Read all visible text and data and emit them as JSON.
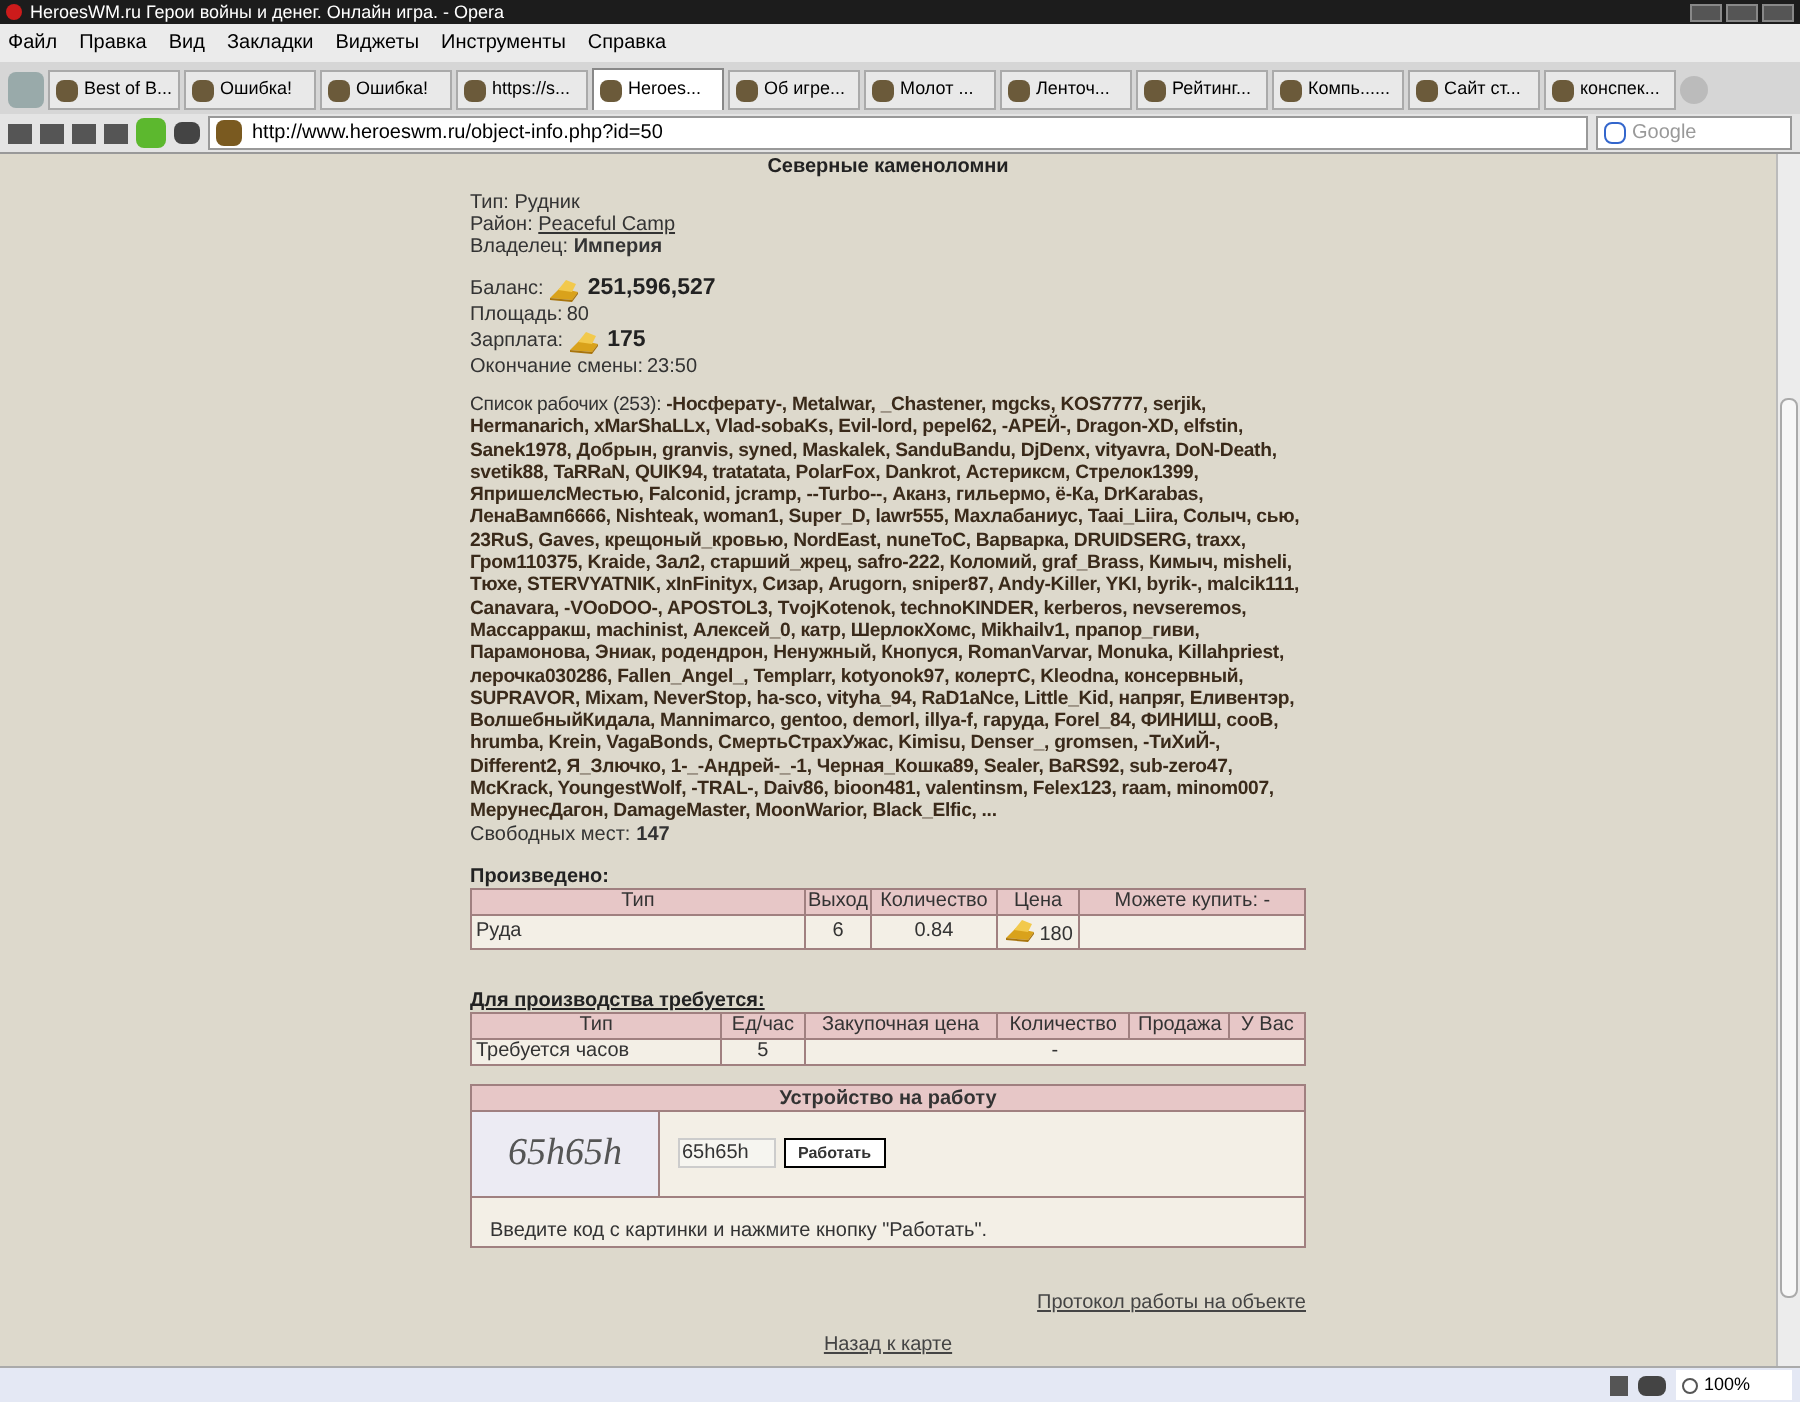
{
  "window": {
    "title": "HeroesWM.ru Герои войны и денег. Онлайн игра. - Opera"
  },
  "menu": [
    "Файл",
    "Правка",
    "Вид",
    "Закладки",
    "Виджеты",
    "Инструменты",
    "Справка"
  ],
  "tabs": [
    {
      "label": "Best of B...",
      "selected": false
    },
    {
      "label": "Ошибка!",
      "selected": false
    },
    {
      "label": "Ошибка!",
      "selected": false
    },
    {
      "label": "https://s...",
      "selected": false
    },
    {
      "label": "Heroes...",
      "selected": true
    },
    {
      "label": "Об игре...",
      "selected": false
    },
    {
      "label": "Молот ...",
      "selected": false
    },
    {
      "label": "Ленточ...",
      "selected": false
    },
    {
      "label": "Рейтинг...",
      "selected": false
    },
    {
      "label": "Компь......",
      "selected": false
    },
    {
      "label": "Сайт ст...",
      "selected": false
    },
    {
      "label": "конспек...",
      "selected": false
    }
  ],
  "address_bar": {
    "url": "http://www.heroeswm.ru/object-info.php?id=50",
    "search_placeholder": "Google"
  },
  "page": {
    "title": "Северные каменоломни",
    "info": [
      {
        "label": "Тип:",
        "value": "Рудник",
        "kind": "plain"
      },
      {
        "label": "Район:",
        "value": "Peaceful Camp",
        "kind": "link"
      },
      {
        "label": "Владелец:",
        "value": "Империя",
        "kind": "bold"
      }
    ],
    "stats": [
      {
        "label": "Баланс:",
        "value": "251,596,527",
        "kind": "gold"
      },
      {
        "label": "Площадь:",
        "value": "80",
        "kind": "plain"
      },
      {
        "label": "Зарплата:",
        "value": "175",
        "kind": "gold"
      },
      {
        "label": "Окончание смены:",
        "value": "23:50",
        "kind": "plain"
      }
    ],
    "workers": {
      "label": "Список рабочих (253):",
      "names": "-Носферату-, Metalwar, _Chastener, mgcks, KOS7777, serjik, Hermanarich, xMarShaLLx, Vlad-sobaKs, Evil-lord, pepel62, -АРЕЙ-, Dragon-XD, elfstin, Sanek1978, Добрын, granvis, syned, Maskalek, SanduBandu, DjDenx, vityavra, DoN-Death, svetik88, TaRRaN, QUIK94, tratatata, PolarFox, Dankrot, Астериксм, Стрелок1399, ЯпришелсМестью, Falconid, jcramp, --Turbo--, Аканз, гильермо, ё-Ка, DrKarabas, ЛенаВамп6666, Nishteak, woman1, Super_D, lawr555, Махлабаниус, Taai_Liira, Солыч, сью, 23RuS, Gaves, крещоный_кровью, NordEast, nuneToC, Варварка, DRUIDSERG, traxx, Гром110375, Kraide, Зал2, старший_жрец, safro-222, Коломий, graf_Brass, Кимыч, misheli, Тюхе, STERVYATNIK, xInFinityx, Сизар, Arugorn, sniper87, Andy-Killer, YKI, byrik-, malcik111, Canavara, -VOoDOO-, APOSTOL3, TvojKotenok, technoKINDER, kerberos, nevseremos, Массарракш, machinist, Алексей_0, катр, ШерлокХомс, Mikhailv1, прапор_гиви, Парамонова, Эниак, родендрон, Ненужный, Кнопуся, RomanVarvar, Monuka, Killahpriest, лерочка030286, Fallen_Angel_, Templarr, kotyonok97, колертС, Kleodna, консервный, SUPRAVOR, Mixam, NeverStop, ha-sco, vityha_94, RaD1aNce, Little_Kid, напряг, Еливентэр, ВолшебныйКидала, Mannimarco, gentoo, demorl, illya-f, гаруда, Forel_84, ФИНИШ, cooB, hrumba, Krein, VagaBonds, СмертьСтрахУжас, Kimisu, Denser_, gromsen, -ТиХиЙ-, Different2, Я_Злючко, 1-_-Андрей-_-1, Черная_Кошка89, Sealer, BaRS92, sub-zero47, McKrack, YoungestWolf, -TRAL-, Daiv86, bioon481, valentinsm, Felex123, raam, minom007, МерунесДагон, DamageMaster, MoonWarior, Black_Elfic, ..."
    },
    "free_slots": {
      "label": "Свободных мест:",
      "value": "147"
    },
    "produced": {
      "heading": "Произведено:",
      "columns": [
        "Тип",
        "Выход",
        "Количество",
        "Цена",
        "Можете купить: -"
      ],
      "rows": [
        [
          "Руда",
          "6",
          "0.84",
          "180",
          ""
        ]
      ]
    },
    "required": {
      "heading": "Для производства требуется:",
      "columns": [
        "Тип",
        "Ед/час",
        "Закупочная цена",
        "Количество",
        "Продажа",
        "У Вас"
      ],
      "rows": [
        [
          "Требуется часов",
          "5",
          {
            "text": "-",
            "colspan": 4
          }
        ]
      ]
    },
    "employment": {
      "heading": "Устройство на работу",
      "captcha_text": "65h65h",
      "code_value": "65h65h",
      "button": "Работать",
      "hint": "Введите код с картинки и нажмите кнопку \"Работать\"."
    },
    "log_link": "Протокол работы на объекте",
    "back_link": "Назад к карте"
  },
  "status_bar": {
    "zoom": "100%"
  }
}
